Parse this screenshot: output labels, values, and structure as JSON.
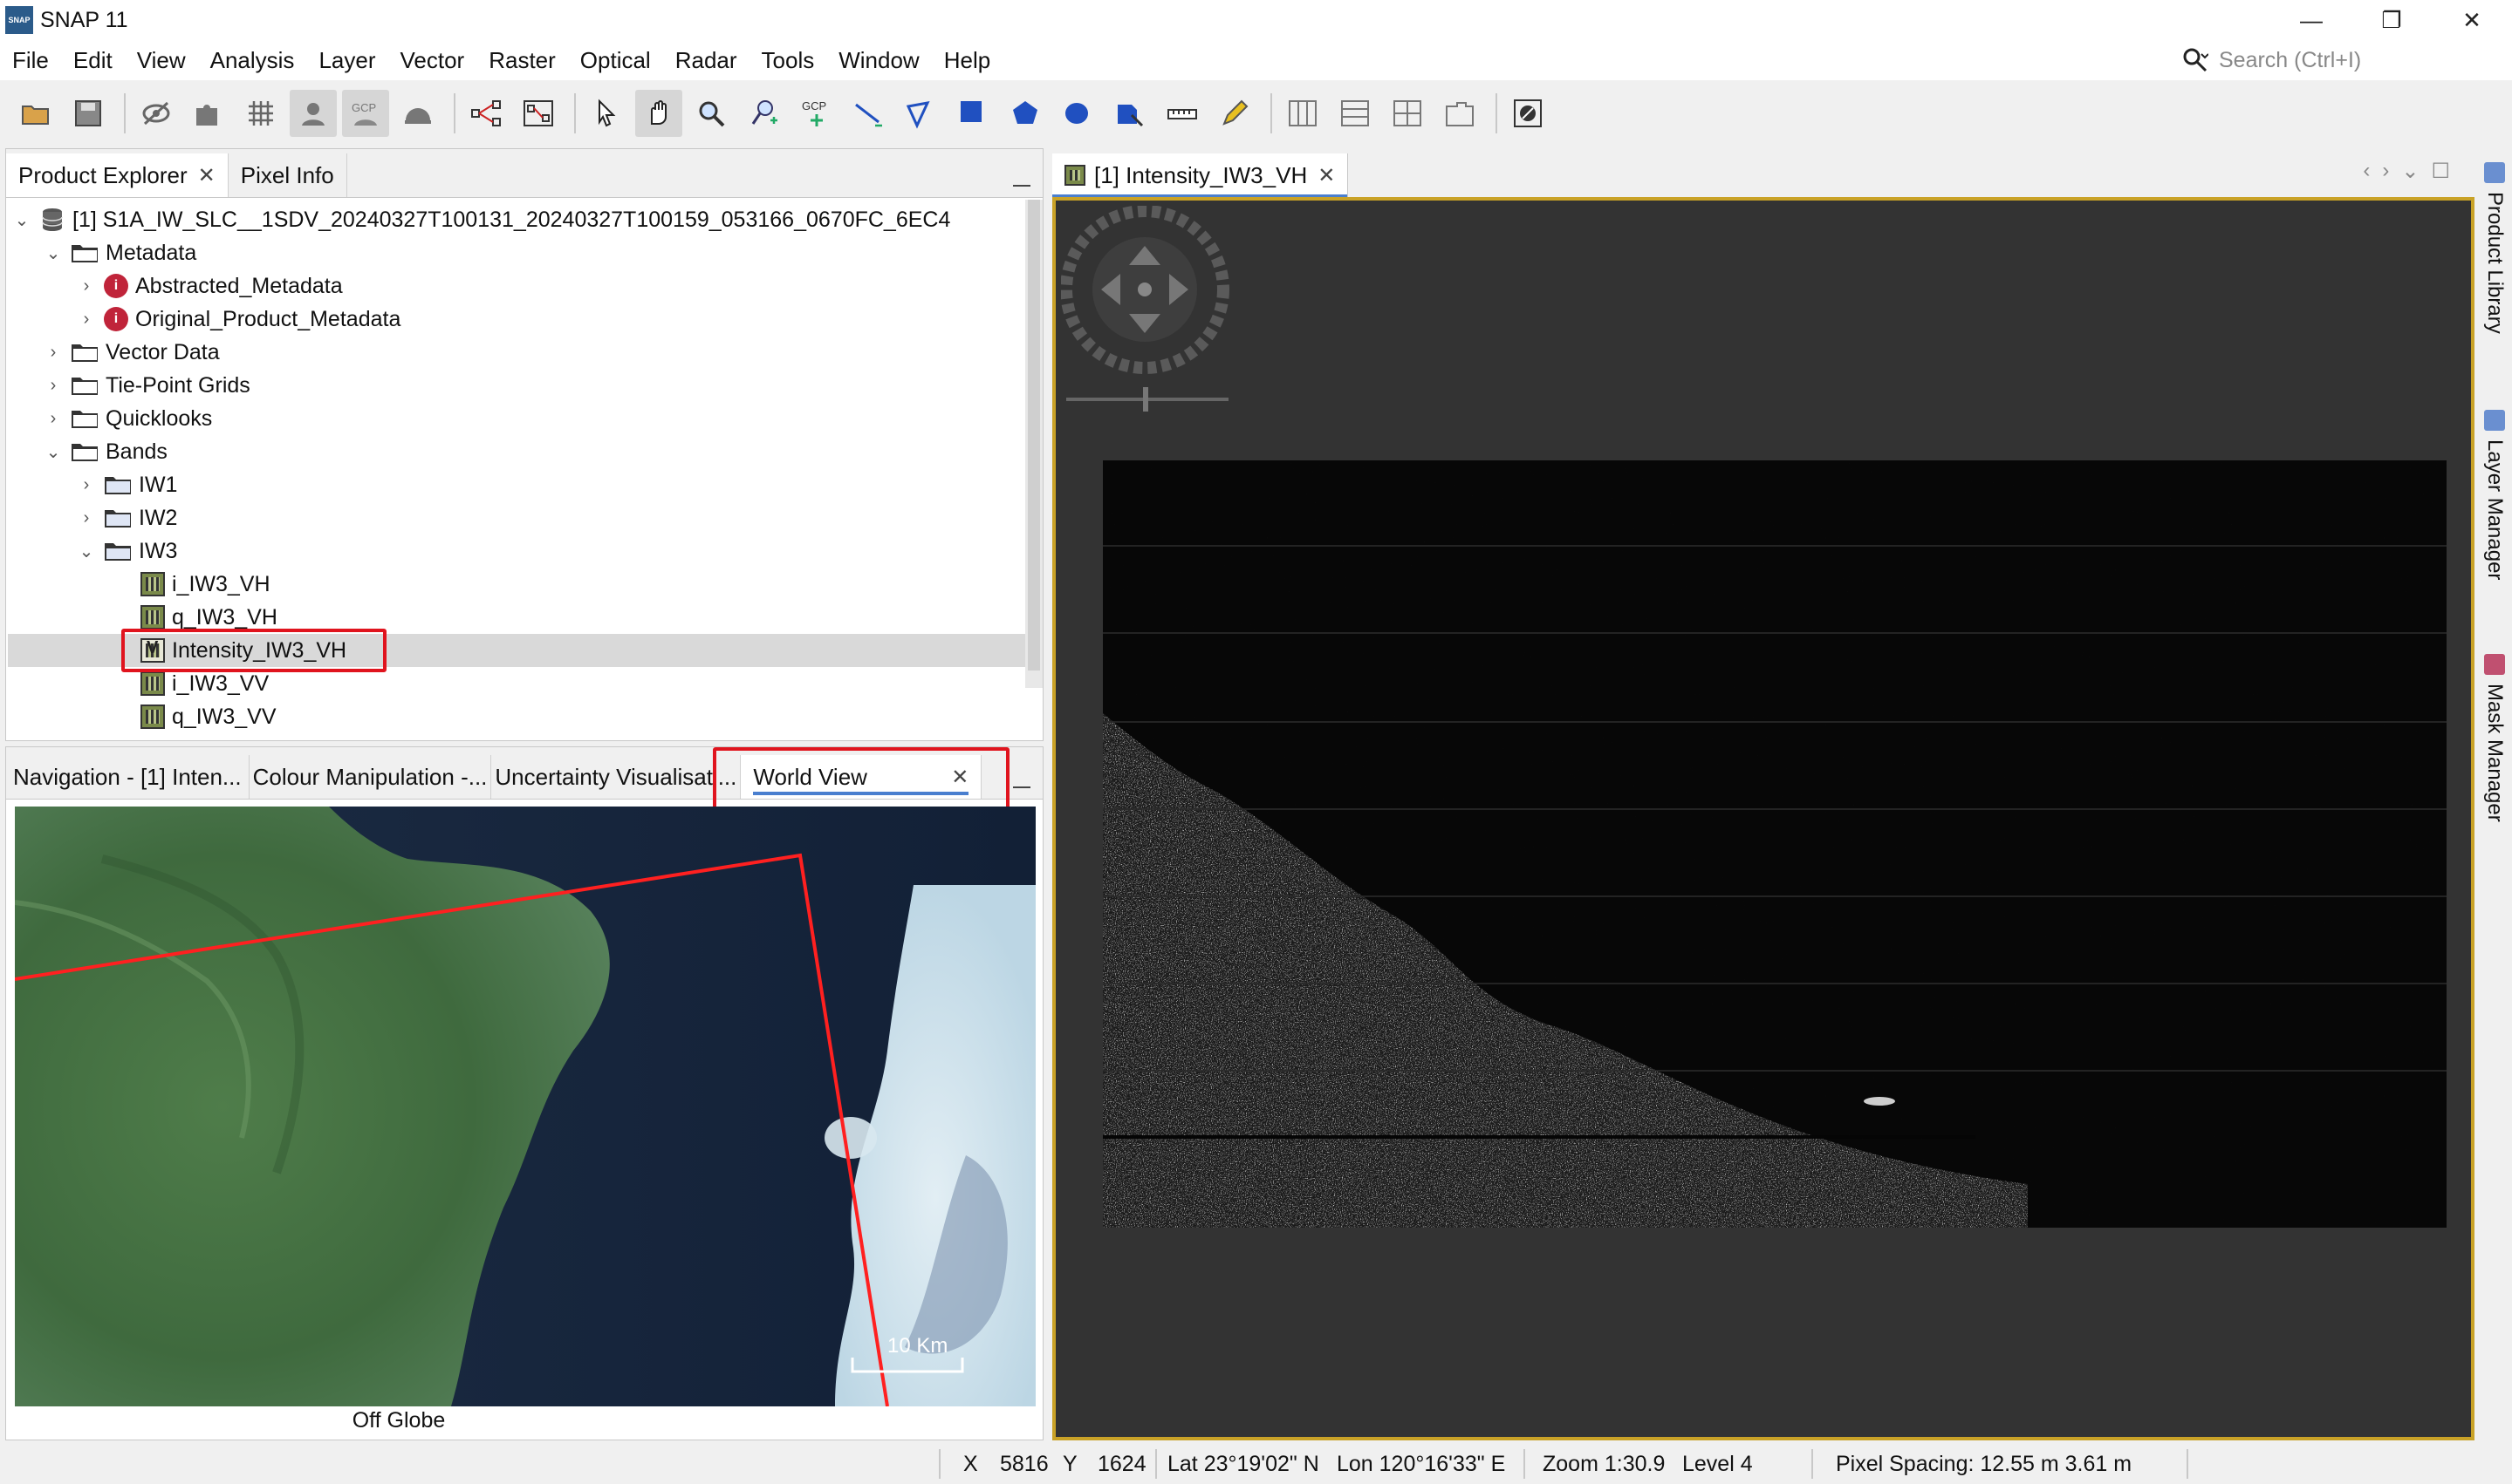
{
  "window": {
    "title": "SNAP 11",
    "logo_text": "SNAP",
    "minimize": "—",
    "maximize": "❐",
    "close": "✕"
  },
  "menu": [
    "File",
    "Edit",
    "View",
    "Analysis",
    "Layer",
    "Vector",
    "Raster",
    "Optical",
    "Radar",
    "Tools",
    "Window",
    "Help"
  ],
  "search": {
    "placeholder": "Search (Ctrl+I)"
  },
  "explorer": {
    "tabs": [
      {
        "label": "Product Explorer",
        "closable": true
      },
      {
        "label": "Pixel Info",
        "closable": false
      }
    ],
    "product": "[1] S1A_IW_SLC__1SDV_20240327T100131_20240327T100159_053166_0670FC_6EC4",
    "tree": {
      "metadata": "Metadata",
      "abstracted": "Abstracted_Metadata",
      "original": "Original_Product_Metadata",
      "vector_data": "Vector Data",
      "tie_point": "Tie-Point Grids",
      "quicklooks": "Quicklooks",
      "bands": "Bands",
      "iw1": "IW1",
      "iw2": "IW2",
      "iw3": "IW3",
      "i_vh": "i_IW3_VH",
      "q_vh": "q_IW3_VH",
      "intensity_vh": "Intensity_IW3_VH",
      "i_vv": "i_IW3_VV",
      "q_vv": "q_IW3_VV",
      "v_badge": "V"
    }
  },
  "world_panel": {
    "tabs": [
      {
        "label": "Navigation - [1] Inten..."
      },
      {
        "label": "Colour Manipulation -..."
      },
      {
        "label": "Uncertainty Visualisati..."
      },
      {
        "label": "World View",
        "closable": true
      }
    ],
    "scale_label": "10 Km",
    "footer": "Off Globe"
  },
  "image_view": {
    "tab_label": "[1] Intensity_IW3_VH"
  },
  "side_tabs": [
    "Product Library",
    "Layer Manager",
    "Mask Manager"
  ],
  "status": {
    "x_label": "X",
    "x_value": "5816",
    "y_label": "Y",
    "y_value": "1624",
    "lat": "Lat 23°19'02\" N",
    "lon": "Lon 120°16'33\" E",
    "zoom": "Zoom 1:30.9",
    "level": "Level 4",
    "pixel_spacing": "Pixel Spacing: 12.55 m 3.61 m"
  },
  "colors": {
    "highlight_red": "#e0141e",
    "view_border": "#c9a227",
    "footprint_line": "#ff2020"
  }
}
